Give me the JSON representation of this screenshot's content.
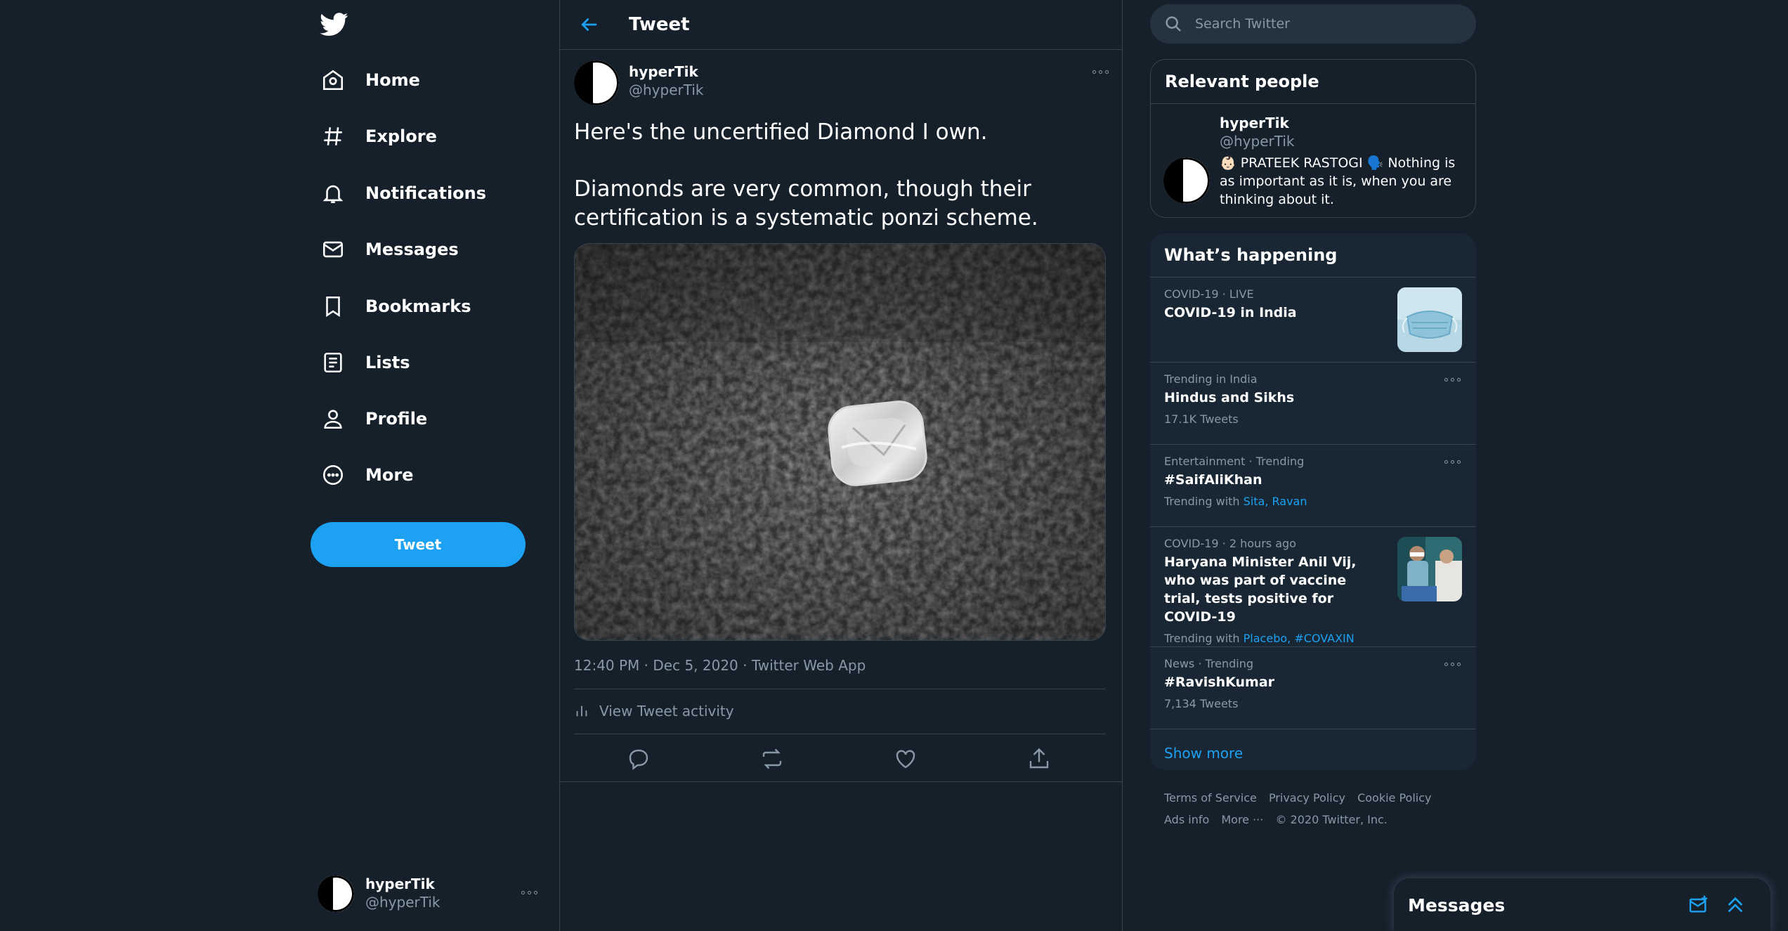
{
  "nav": {
    "items": [
      {
        "label": "Home",
        "icon": "home-icon"
      },
      {
        "label": "Explore",
        "icon": "hashtag-icon"
      },
      {
        "label": "Notifications",
        "icon": "bell-icon"
      },
      {
        "label": "Messages",
        "icon": "envelope-icon"
      },
      {
        "label": "Bookmarks",
        "icon": "bookmark-icon"
      },
      {
        "label": "Lists",
        "icon": "list-icon"
      },
      {
        "label": "Profile",
        "icon": "person-icon"
      },
      {
        "label": "More",
        "icon": "more-circle-icon"
      }
    ],
    "tweet_button": "Tweet",
    "account": {
      "name": "hyperTik",
      "handle": "@hyperTik"
    }
  },
  "header": {
    "title": "Tweet"
  },
  "tweet": {
    "author_name": "hyperTik",
    "author_handle": "@hyperTik",
    "text_line1": "Here's the uncertified Diamond I own.",
    "text_line2": "Diamonds are very common, though their certification is a systematic ponzi scheme.",
    "meta": "12:40 PM · Dec 5, 2020 · Twitter Web App",
    "activity": "View Tweet activity"
  },
  "search": {
    "placeholder": "Search Twitter"
  },
  "relevant": {
    "title": "Relevant people",
    "name": "hyperTik",
    "handle": "@hyperTik",
    "bio": "👶🏻 PRATEEK RASTOGI 🗣️ Nothing is as important as it is, when you are thinking about it."
  },
  "happening": {
    "title": "What’s happening",
    "trends": [
      {
        "meta": "COVID-19 · LIVE",
        "title": "COVID-19 in India"
      },
      {
        "meta": "Trending in India",
        "title": "Hindus and Sikhs",
        "count": "17.1K Tweets"
      },
      {
        "meta": "Entertainment · Trending",
        "title": "#SaifAliKhan",
        "with_prefix": "Trending with",
        "with_links": "Sita, Ravan"
      },
      {
        "meta": "COVID-19 · 2 hours ago",
        "title": "Haryana Minister Anil Vij, who was part of vaccine trial, tests positive for COVID-19",
        "with_prefix": "Trending with",
        "with_links": "Placebo, #COVAXIN"
      },
      {
        "meta": "News · Trending",
        "title": "#RavishKumar",
        "count": "7,134 Tweets"
      }
    ],
    "show_more": "Show more"
  },
  "footer": {
    "links": [
      "Terms of Service",
      "Privacy Policy",
      "Cookie Policy",
      "Ads info",
      "More ···"
    ],
    "copyright": "© 2020 Twitter, Inc."
  },
  "messages_drawer": {
    "title": "Messages"
  },
  "colors": {
    "background": "#15202b",
    "card": "#192734",
    "accent": "#1da1f2",
    "muted": "#8899a6",
    "border": "#38444d"
  }
}
